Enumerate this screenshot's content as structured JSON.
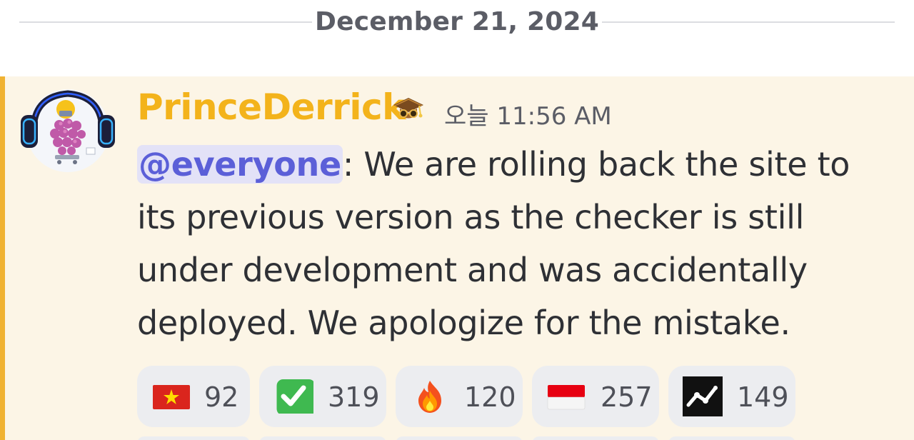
{
  "date_divider": {
    "text": "December 21, 2024"
  },
  "message": {
    "author": "PrinceDerrick",
    "timestamp": "오늘 11:56 AM",
    "mention": "@everyone",
    "text": ": We are rolling back the site to its previous version as the checker is still under development and was accidentally deployed. We apologize for the mistake."
  },
  "reactions": [
    {
      "emoji": "vietnam-flag",
      "count": "92"
    },
    {
      "emoji": "white-check-mark",
      "count": "319"
    },
    {
      "emoji": "fire",
      "count": "120"
    },
    {
      "emoji": "indonesia-flag",
      "count": "257"
    },
    {
      "emoji": "chart-logo",
      "count": "149"
    }
  ],
  "colors": {
    "mention_bar": "#f0b232",
    "message_highlight": "#fcf5e6",
    "username": "#f3b31b",
    "mention_bg": "#e3e2f7",
    "mention_text": "#5b5fd8",
    "reaction_bg": "#ecedf0"
  }
}
